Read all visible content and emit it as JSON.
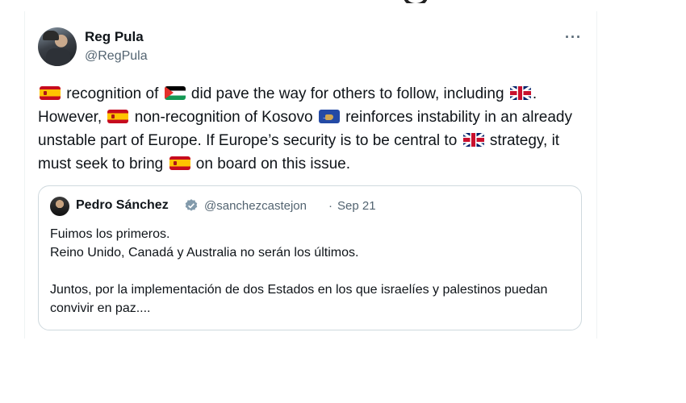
{
  "tweet": {
    "author_name": "Reg Pula",
    "author_handle": "@RegPula",
    "more_label": "···",
    "text_parts": [
      " recognition of ",
      " did pave the way for others to follow, including ",
      ". However, ",
      " non-recognition of Kosovo ",
      " reinforces instability in an already unstable part of Europe. If Europe’s security is to be central to ",
      " strategy, it must seek to bring ",
      " on board on this issue."
    ],
    "flags": [
      "spain-flag-icon",
      "palestine-flag-icon",
      "uk-flag-icon",
      "spain-flag-icon",
      "kosovo-flag-icon",
      "uk-flag-icon",
      "spain-flag-icon"
    ]
  },
  "quote": {
    "author_name": "Pedro Sánchez",
    "verified_icon": "verified-badge-icon",
    "author_handle": "@sanchezcastejon",
    "separator": "·",
    "date": "Sep 21",
    "lines": [
      "Fuimos los primeros.",
      "Reino Unido, Canadá y Australia no serán los últimos.",
      "Juntos, por la implementación de dos Estados en los que israelíes y palestinos puedan convivir en paz...."
    ]
  },
  "colors": {
    "text": "#0f1419",
    "secondary": "#536471",
    "border": "#cfd9de",
    "verified": "#829aab"
  }
}
